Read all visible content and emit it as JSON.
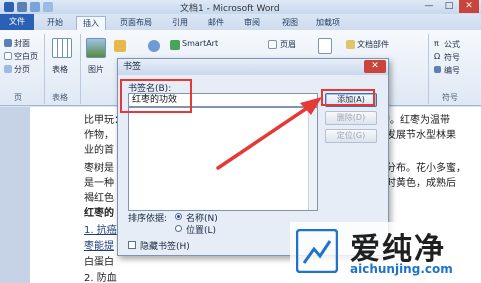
{
  "window": {
    "title": "文档1 - Microsoft Word"
  },
  "tabs": [
    {
      "label": "文件"
    },
    {
      "label": "开始"
    },
    {
      "label": "插入"
    },
    {
      "label": "页面布局"
    },
    {
      "label": "引用"
    },
    {
      "label": "邮件"
    },
    {
      "label": "审阅"
    },
    {
      "label": "视图"
    },
    {
      "label": "加载项"
    }
  ],
  "ribbon": {
    "pages_group": {
      "items": [
        "封面",
        "空白页",
        "分页"
      ],
      "label": "页"
    },
    "table_group": {
      "button": "表格",
      "label": "表格"
    },
    "picture_button": "图片",
    "smartart": "SmartArt",
    "header_button": "页眉",
    "docparts": "文档部件",
    "formula": "公式",
    "symbol": "符号",
    "number": "编号",
    "symbols_group_label": "符号"
  },
  "document": {
    "lines": [
      "比甲玩：",
      "作物，",
      "业的首",
      "枣树是",
      "是一种",
      "褐红色",
      "红枣的",
      "1. 抗癌",
      "枣能提",
      "白蛋白",
      "2. 防血"
    ],
    "right_fragments": [
      "的美誉。红枣为温带",
      "是发展节水型林果",
      "有分布。花小多蜜，",
      "熟时黄色，成熟后"
    ]
  },
  "dialog": {
    "title": "书签",
    "name_label": "书签名(B):",
    "name_value": "红枣的功效",
    "buttons": {
      "add": "添加(A)",
      "delete": "删除(D)",
      "goto": "定位(G)"
    },
    "sort_label": "排序依据:",
    "sort_options": [
      "名称(N)",
      "位置(L)"
    ],
    "hidden_label": "隐藏书签(H)",
    "close_symbol": "✕"
  },
  "watermark": {
    "text": "爱纯净",
    "url": "aichunjing.com"
  }
}
